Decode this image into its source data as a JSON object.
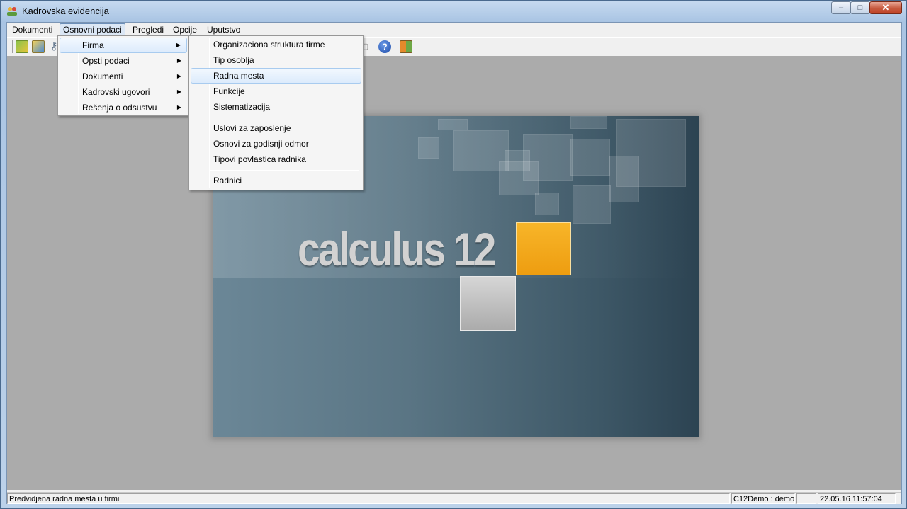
{
  "window": {
    "title": "Kadrovska evidencija",
    "buttons": {
      "minimize": "–",
      "maximize": "□",
      "close": "✕"
    }
  },
  "menubar": {
    "items": [
      "Dokumenti",
      "Osnovni podaci",
      "Pregledi",
      "Opcije",
      "Uputstvo"
    ],
    "active": "Osnovni podaci"
  },
  "toolbar": {
    "icons": [
      "open-icon",
      "settings-icon",
      "tools-icon",
      "print-icon",
      "help-icon",
      "exit-icon"
    ],
    "help_glyph": "?"
  },
  "osnovni_menu": {
    "items": [
      {
        "label": "Firma",
        "submenu": true
      },
      {
        "label": "Opsti podaci",
        "submenu": true
      },
      {
        "label": "Dokumenti",
        "submenu": true
      },
      {
        "label": "Kadrovski ugovori",
        "submenu": true
      },
      {
        "label": "Rešenja o odsustvu",
        "submenu": true
      }
    ],
    "arrow": "▶"
  },
  "firma_submenu": {
    "items": [
      "Organizaciona struktura firme",
      "Tip osoblja",
      "Radna mesta",
      "Funkcije",
      "Sistematizacija",
      "Uslovi za zaposlenje",
      "Osnovi za godisnji odmor",
      "Tipovi povlastica radnika",
      "Radnici"
    ],
    "highlighted": "Radna mesta"
  },
  "splash": {
    "logo_text": "calculus 12",
    "accent_color": "#f2a818"
  },
  "statusbar": {
    "hint": "Predvidjena radna mesta u firmi",
    "user": "C12Demo : demo",
    "datetime": "22.05.16 11:57:04"
  }
}
